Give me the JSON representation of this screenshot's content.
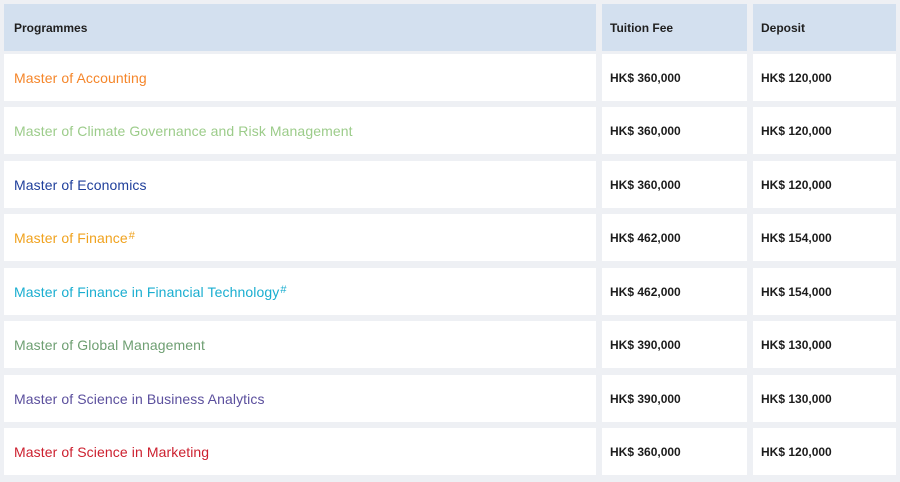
{
  "header": {
    "programmes": "Programmes",
    "tuition_fee": "Tuition Fee",
    "deposit": "Deposit"
  },
  "rows": [
    {
      "programme": "Master of Accounting",
      "mark": "",
      "tuition": "HK$ 360,000",
      "deposit": "HK$ 120,000",
      "color": "#f5862a"
    },
    {
      "programme": "Master of Climate Governance and Risk Management",
      "mark": "",
      "tuition": "HK$ 360,000",
      "deposit": "HK$ 120,000",
      "color": "#9ccc8a"
    },
    {
      "programme": "Master of Economics",
      "mark": "",
      "tuition": "HK$ 360,000",
      "deposit": "HK$ 120,000",
      "color": "#1f3f9b"
    },
    {
      "programme": "Master of Finance",
      "mark": "#",
      "tuition": "HK$ 462,000",
      "deposit": "HK$ 154,000",
      "color": "#f0a21e"
    },
    {
      "programme": "Master of Finance in Financial Technology",
      "mark": "#",
      "tuition": "HK$ 462,000",
      "deposit": "HK$ 154,000",
      "color": "#1aaed0"
    },
    {
      "programme": "Master of Global Management",
      "mark": "",
      "tuition": "HK$ 390,000",
      "deposit": "HK$ 130,000",
      "color": "#6e9f72"
    },
    {
      "programme": "Master of Science in Business Analytics",
      "mark": "",
      "tuition": "HK$ 390,000",
      "deposit": "HK$ 130,000",
      "color": "#5b4f9d"
    },
    {
      "programme": "Master of Science in Marketing",
      "mark": "",
      "tuition": "HK$ 360,000",
      "deposit": "HK$ 120,000",
      "color": "#cc1f2e"
    }
  ]
}
